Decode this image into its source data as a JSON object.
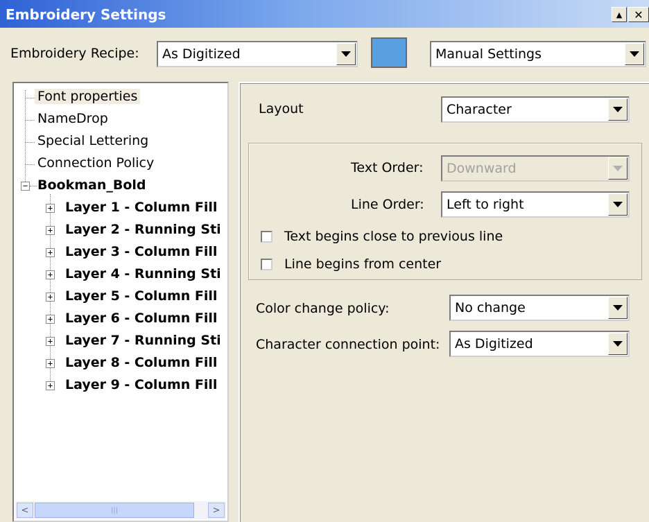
{
  "window": {
    "title": "Embroidery Settings",
    "minimize_glyph": "▲",
    "close_glyph": "✕"
  },
  "recipe": {
    "label": "Embroidery Recipe:",
    "value": "As Digitized",
    "swatch_color": "#5aa0e0",
    "settings_value": "Manual Settings"
  },
  "tree": {
    "items": [
      {
        "label": "Font properties",
        "selected": true
      },
      {
        "label": "NameDrop"
      },
      {
        "label": "Special Lettering"
      },
      {
        "label": "Connection Policy"
      }
    ],
    "font_node": {
      "label": "Bookman_Bold",
      "expander": "−"
    },
    "layers": [
      {
        "label": "Layer 1 - Column Fill",
        "expander": "+"
      },
      {
        "label": "Layer 2 - Running Sti",
        "expander": "+"
      },
      {
        "label": "Layer 3 - Column Fill",
        "expander": "+"
      },
      {
        "label": "Layer 4 - Running Sti",
        "expander": "+"
      },
      {
        "label": "Layer 5 - Column Fill",
        "expander": "+"
      },
      {
        "label": "Layer 6 - Column Fill",
        "expander": "+"
      },
      {
        "label": "Layer 7 - Running Sti",
        "expander": "+"
      },
      {
        "label": "Layer 8 - Column Fill",
        "expander": "+"
      },
      {
        "label": "Layer 9 - Column Fill",
        "expander": "+"
      }
    ],
    "scroll": {
      "left": "<",
      "right": ">",
      "grip": "|||"
    }
  },
  "props": {
    "layout_label": "Layout",
    "layout_value": "Character",
    "text_order_label": "Text Order:",
    "text_order_value": "Downward",
    "line_order_label": "Line Order:",
    "line_order_value": "Left to right",
    "check_close_prev": "Text begins close to previous line",
    "check_center": "Line begins from center",
    "color_policy_label": "Color change policy:",
    "color_policy_value": "No change",
    "connection_label": "Character connection point:",
    "connection_value": "As Digitized"
  }
}
